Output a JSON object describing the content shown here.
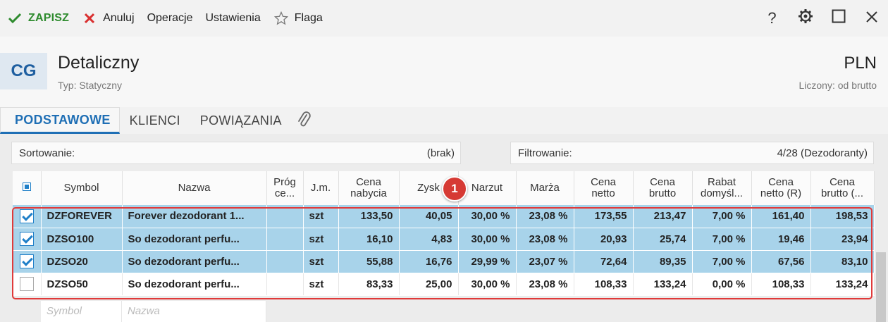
{
  "toolbar": {
    "save_label": "ZAPISZ",
    "cancel_label": "Anuluj",
    "operations_label": "Operacje",
    "settings_label": "Ustawienia",
    "flag_label": "Flaga",
    "help_label": "?"
  },
  "header": {
    "avatar": "CG",
    "title": "Detaliczny",
    "subtitle": "Typ: Statyczny",
    "currency": "PLN",
    "currency_sub": "Liczony: od brutto"
  },
  "tabs": [
    {
      "label": "PODSTAWOWE"
    },
    {
      "label": "KLIENCI"
    },
    {
      "label": "POWIĄZANIA"
    }
  ],
  "sort": {
    "label": "Sortowanie:",
    "value": "(brak)"
  },
  "filter": {
    "label": "Filtrowanie:",
    "value": "4/28 (Dezodoranty)"
  },
  "columns": [
    "Symbol",
    "Nazwa",
    "Próg ce...",
    "J.m.",
    "Cena nabycia",
    "Zysk",
    "Narzut",
    "Marża",
    "Cena netto",
    "Cena brutto",
    "Rabat domyśl...",
    "Cena netto (R)",
    "Cena brutto (..."
  ],
  "columns_split": [
    [
      "Symbol"
    ],
    [
      "Nazwa"
    ],
    [
      "Próg",
      "ce..."
    ],
    [
      "J.m."
    ],
    [
      "Cena",
      "nabycia"
    ],
    [
      "Zysk"
    ],
    [
      "Narzut"
    ],
    [
      "Marża"
    ],
    [
      "Cena",
      "netto"
    ],
    [
      "Cena",
      "brutto"
    ],
    [
      "Rabat",
      "domyśl..."
    ],
    [
      "Cena",
      "netto (R)"
    ],
    [
      "Cena",
      "brutto (..."
    ]
  ],
  "rows": [
    {
      "checked": true,
      "symbol": "DZFOREVER",
      "name": "Forever dezodorant 1...",
      "threshold": "",
      "unit": "szt",
      "cost": "133,50",
      "profit": "40,05",
      "markup": "30,00 %",
      "margin": "23,08 %",
      "net": "173,55",
      "gross": "213,47",
      "discount": "7,00 %",
      "net_r": "161,40",
      "gross_r": "198,53"
    },
    {
      "checked": true,
      "symbol": "DZSO100",
      "name": "So dezodorant perfu...",
      "threshold": "",
      "unit": "szt",
      "cost": "16,10",
      "profit": "4,83",
      "markup": "30,00 %",
      "margin": "23,08 %",
      "net": "20,93",
      "gross": "25,74",
      "discount": "7,00 %",
      "net_r": "19,46",
      "gross_r": "23,94"
    },
    {
      "checked": true,
      "symbol": "DZSO20",
      "name": "So dezodorant perfu...",
      "threshold": "",
      "unit": "szt",
      "cost": "55,88",
      "profit": "16,76",
      "markup": "29,99 %",
      "margin": "23,07 %",
      "net": "72,64",
      "gross": "89,35",
      "discount": "7,00 %",
      "net_r": "67,56",
      "gross_r": "83,10"
    },
    {
      "checked": false,
      "symbol": "DZSO50",
      "name": "So dezodorant perfu...",
      "threshold": "",
      "unit": "szt",
      "cost": "83,33",
      "profit": "25,00",
      "markup": "30,00 %",
      "margin": "23,08 %",
      "net": "108,33",
      "gross": "133,24",
      "discount": "0,00 %",
      "net_r": "108,33",
      "gross_r": "133,24"
    }
  ],
  "new_row": {
    "symbol_placeholder": "Symbol",
    "name_placeholder": "Nazwa"
  },
  "badge": "1",
  "colors": {
    "accent": "#1f6fb5",
    "save": "#2e8b2e",
    "cancel": "#d93030",
    "selection": "#a8d3ea",
    "highlight": "#e03a3a"
  }
}
